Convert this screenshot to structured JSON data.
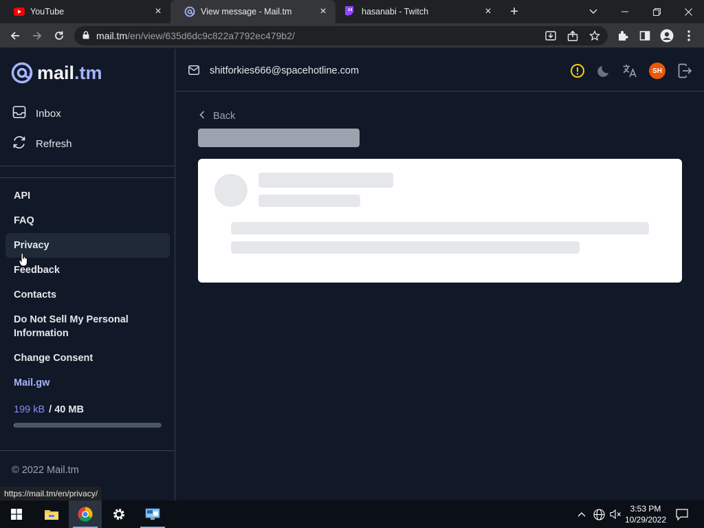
{
  "browser": {
    "tabs": [
      {
        "title": "YouTube",
        "icon": "youtube-icon"
      },
      {
        "title": "View message - Mail.tm",
        "icon": "mail-tm-icon"
      },
      {
        "title": "hasanabi - Twitch",
        "icon": "twitch-icon"
      }
    ],
    "url_host": "mail.tm",
    "url_path": "/en/view/635d6dc9c822a7792ec479b2/",
    "status_url": "https://mail.tm/en/privacy/"
  },
  "sidebar": {
    "logo_text_main": "mail",
    "logo_text_accent": ".tm",
    "nav": [
      {
        "label": "Inbox",
        "icon": "inbox-icon"
      },
      {
        "label": "Refresh",
        "icon": "refresh-icon"
      }
    ],
    "links": [
      {
        "label": "API"
      },
      {
        "label": "FAQ"
      },
      {
        "label": "Privacy"
      },
      {
        "label": "Feedback"
      },
      {
        "label": "Contacts"
      },
      {
        "label": "Do Not Sell My Personal Information"
      },
      {
        "label": "Change Consent"
      },
      {
        "label": "Mail.gw"
      }
    ],
    "storage_used": "199 kB",
    "storage_total": "/ 40 MB",
    "storage_fraction": 0.005,
    "copyright": "© 2022 Mail.tm"
  },
  "header": {
    "email": "shitforkies666@spacehotline.com",
    "avatar_initials": "SH"
  },
  "main": {
    "back_label": "Back"
  },
  "taskbar": {
    "time": "3:53 PM",
    "date": "10/29/2022"
  },
  "colors": {
    "accent": "#818cf8",
    "background": "#111827",
    "avatar": "#ea580c",
    "warning": "#facc15"
  }
}
